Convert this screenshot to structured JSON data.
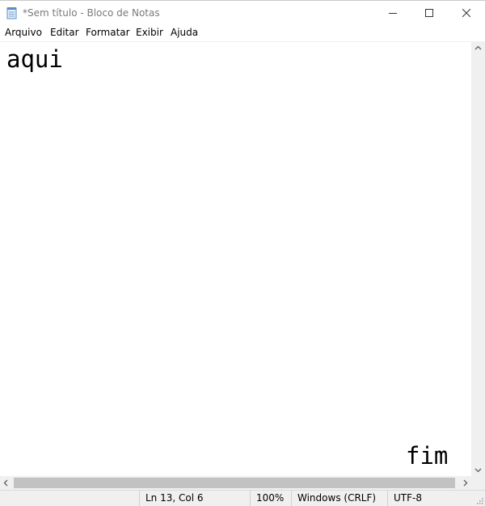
{
  "window": {
    "title": "*Sem título - Bloco de Notas",
    "icon": "notepad-icon",
    "controls": {
      "minimize": "minimize-icon",
      "maximize": "maximize-icon",
      "close": "close-icon"
    }
  },
  "menu": {
    "items": [
      "Arquivo",
      "Editar",
      "Formatar",
      "Exibir",
      "Ajuda"
    ]
  },
  "editor": {
    "lines": {
      "first": "aqui",
      "last": "fim"
    }
  },
  "statusbar": {
    "position": "Ln 13, Col 6",
    "zoom": "100%",
    "line_ending": "Windows (CRLF)",
    "encoding": "UTF-8"
  },
  "colors": {
    "title_text": "#7a7a7a",
    "chrome_bg": "#f0f0f0",
    "scroll_thumb": "#c2c2c2"
  }
}
